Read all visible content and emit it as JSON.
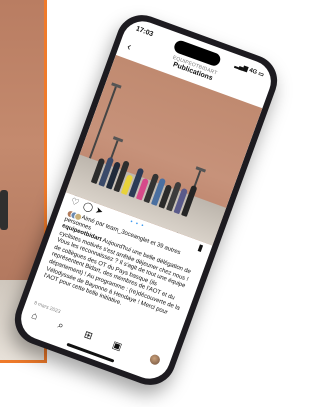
{
  "status_bar": {
    "time": "17:03",
    "signal": "4G"
  },
  "header": {
    "account": "EQUIPEOTBIDART",
    "title": "Publications"
  },
  "post": {
    "carousel_indicator": "• • •",
    "likes": {
      "text": "Aimé par team_3oceanglet et 39 autres personnes"
    },
    "caption": {
      "username": "equipeotbidart",
      "text": "Aujourd'hui une belle délégation de cyclistes motivés s'est arrêtée déjeuner chez nous ! Vous les reconnaissez ? Il s'agit de tout une équipe de collègues des OT du Pays basque (ils représentent Bidart, des membres de l'AOT et du département) ! Au programme : (re)découverte de la Vélodyssée de Bayonne à Hendaye ! Merci pour l'AOT pour cette belle initiative."
    },
    "date": "8 mars 2023"
  },
  "tab_bar": {
    "icons": [
      "home-icon",
      "search-icon",
      "new-post-icon",
      "shop-icon",
      "profile-icon"
    ]
  }
}
